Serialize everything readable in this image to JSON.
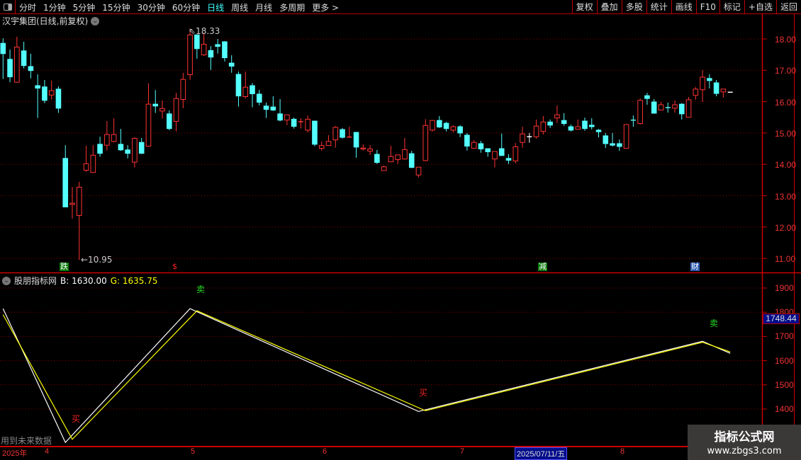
{
  "toolbar": {
    "periods": [
      "分时",
      "1分钟",
      "5分钟",
      "15分钟",
      "30分钟",
      "60分钟",
      "日线",
      "周线",
      "月线",
      "多周期",
      "更多 >"
    ],
    "active_period": "日线",
    "buttons": [
      "复权",
      "叠加",
      "多股",
      "统计",
      "画线",
      "F10",
      "标记",
      "+自选",
      "返回"
    ]
  },
  "stock": {
    "title": "汉宇集团(日线,前复权)"
  },
  "price_axis": {
    "labels": [
      "18.00",
      "17.00",
      "16.00",
      "15.00",
      "14.00",
      "13.00",
      "12.00",
      "11.00"
    ]
  },
  "annotations": {
    "high": "18.33",
    "low": "10.95",
    "markers": [
      {
        "text": "跌",
        "type": "green"
      },
      {
        "text": "$",
        "type": "red"
      },
      {
        "text": "减",
        "type": "green"
      },
      {
        "text": "财",
        "type": "blue"
      }
    ]
  },
  "indicator": {
    "name": "股朋指标网",
    "b_label": "B: 1630.00",
    "g_label": "G: 1635.75",
    "current_value": "1748.44",
    "axis_labels": [
      "1900",
      "1800",
      "1700",
      "1600",
      "1500",
      "1400"
    ],
    "signals": [
      {
        "text": "卖",
        "color": "#22dd22"
      },
      {
        "text": "买",
        "color": "#ee2222"
      },
      {
        "text": "买",
        "color": "#ee2222"
      },
      {
        "text": "卖",
        "color": "#22dd22"
      }
    ],
    "warning": "用到未来数据"
  },
  "date_axis": {
    "year": "2025年",
    "months": [
      "4",
      "5",
      "6",
      "7",
      "8"
    ],
    "cursor_date": "2025/07/11/五"
  },
  "watermark": {
    "line1": "指标公式网",
    "line2": "www.zbgs3.com"
  },
  "colors": {
    "up": "#ff3333",
    "down": "#54ffff",
    "grid": "#8b0000",
    "b_line": "#ffffff",
    "g_line": "#ffff00"
  },
  "chart_data": {
    "type": "candlestick",
    "ohlc_fields": [
      "open",
      "high",
      "low",
      "close"
    ],
    "ylim": [
      10.8,
      18.5
    ],
    "candles": [
      [
        17.86,
        18.02,
        16.72,
        17.53
      ],
      [
        17.35,
        17.66,
        16.62,
        16.79
      ],
      [
        16.62,
        18.07,
        16.62,
        17.74
      ],
      [
        17.62,
        17.91,
        17.06,
        17.15
      ],
      [
        17.12,
        17.53,
        16.74,
        16.99
      ],
      [
        16.51,
        16.87,
        15.48,
        16.43
      ],
      [
        16.47,
        16.69,
        15.95,
        16.04
      ],
      [
        16.21,
        16.67,
        16.07,
        16.35
      ],
      [
        16.4,
        16.49,
        15.64,
        15.79
      ],
      [
        14.19,
        14.61,
        12.64,
        12.64
      ],
      [
        12.72,
        13.28,
        12.27,
        12.76
      ],
      [
        12.37,
        13.44,
        10.95,
        13.27
      ],
      [
        13.81,
        14.59,
        13.76,
        14.02
      ],
      [
        13.74,
        14.61,
        13.74,
        14.29
      ],
      [
        14.64,
        14.88,
        14.24,
        14.35
      ],
      [
        14.61,
        15.38,
        14.44,
        14.95
      ],
      [
        14.73,
        15.47,
        14.7,
        14.95
      ],
      [
        14.64,
        15.13,
        14.43,
        14.46
      ],
      [
        14.46,
        14.61,
        14.19,
        14.35
      ],
      [
        14.07,
        14.86,
        13.9,
        14.83
      ],
      [
        14.7,
        14.84,
        14.33,
        14.35
      ],
      [
        14.58,
        16.58,
        14.56,
        15.92
      ],
      [
        15.92,
        16.37,
        15.64,
        15.86
      ],
      [
        15.7,
        16.04,
        15.46,
        15.78
      ],
      [
        15.61,
        15.72,
        15.09,
        15.14
      ],
      [
        15.37,
        16.28,
        15.05,
        16.1
      ],
      [
        16.07,
        16.92,
        15.79,
        16.71
      ],
      [
        16.86,
        18.33,
        16.7,
        18.13
      ],
      [
        18.13,
        18.13,
        17.37,
        17.69
      ],
      [
        17.49,
        18.2,
        17.46,
        17.83
      ],
      [
        17.63,
        17.77,
        17.01,
        17.42
      ],
      [
        17.82,
        18.0,
        17.53,
        17.76
      ],
      [
        17.91,
        17.93,
        17.28,
        17.4
      ],
      [
        17.23,
        17.48,
        16.92,
        17.13
      ],
      [
        16.87,
        16.96,
        15.84,
        16.18
      ],
      [
        16.16,
        16.96,
        16.1,
        16.46
      ],
      [
        16.51,
        16.59,
        15.82,
        16.25
      ],
      [
        16.24,
        16.37,
        15.88,
        15.98
      ],
      [
        15.86,
        15.97,
        15.48,
        15.75
      ],
      [
        15.83,
        16.17,
        15.7,
        15.73
      ],
      [
        15.61,
        16.08,
        15.37,
        15.41
      ],
      [
        15.41,
        15.58,
        15.25,
        15.58
      ],
      [
        15.44,
        15.49,
        15.14,
        15.21
      ],
      [
        15.35,
        15.47,
        15.14,
        15.36
      ],
      [
        15.09,
        15.56,
        15.02,
        15.44
      ],
      [
        15.38,
        15.38,
        14.58,
        14.64
      ],
      [
        14.51,
        14.73,
        14.43,
        14.6
      ],
      [
        14.6,
        14.93,
        14.6,
        14.73
      ],
      [
        14.78,
        15.22,
        14.53,
        15.18
      ],
      [
        15.11,
        15.16,
        14.82,
        14.86
      ],
      [
        14.85,
        15.2,
        14.85,
        14.87
      ],
      [
        15.02,
        15.02,
        14.21,
        14.55
      ],
      [
        14.49,
        14.64,
        14.44,
        14.52
      ],
      [
        14.42,
        14.61,
        14.3,
        14.49
      ],
      [
        14.32,
        14.46,
        14.01,
        14.06
      ],
      [
        13.8,
        13.96,
        13.8,
        13.92
      ],
      [
        14.08,
        14.59,
        14.08,
        14.25
      ],
      [
        14.15,
        14.3,
        14.01,
        14.3
      ],
      [
        14.17,
        14.84,
        14.15,
        14.47
      ],
      [
        14.34,
        14.43,
        13.88,
        13.9
      ],
      [
        13.66,
        13.91,
        13.58,
        13.91
      ],
      [
        14.12,
        15.44,
        14.1,
        15.24
      ],
      [
        15.09,
        15.4,
        15.05,
        15.4
      ],
      [
        15.4,
        15.54,
        15.16,
        15.19
      ],
      [
        15.31,
        15.36,
        15.05,
        15.14
      ],
      [
        15.09,
        15.25,
        15.02,
        15.2
      ],
      [
        15.2,
        15.25,
        14.87,
        15.0
      ],
      [
        14.93,
        15.0,
        14.44,
        14.58
      ],
      [
        14.51,
        14.77,
        14.51,
        14.7
      ],
      [
        14.66,
        14.75,
        14.37,
        14.49
      ],
      [
        14.5,
        14.5,
        14.24,
        14.4
      ],
      [
        14.17,
        14.41,
        13.9,
        14.41
      ],
      [
        14.5,
        14.98,
        14.28,
        14.28
      ],
      [
        14.19,
        14.32,
        14.01,
        14.13
      ],
      [
        14.11,
        14.68,
        14.03,
        14.56
      ],
      [
        14.7,
        15.2,
        14.53,
        14.97
      ],
      [
        14.88,
        15.0,
        14.69,
        14.88
      ],
      [
        14.88,
        15.43,
        14.82,
        15.22
      ],
      [
        15.05,
        15.54,
        14.95,
        15.35
      ],
      [
        15.35,
        15.43,
        15.16,
        15.25
      ],
      [
        15.48,
        15.88,
        15.32,
        15.58
      ],
      [
        15.4,
        15.63,
        15.23,
        15.3
      ],
      [
        15.2,
        15.27,
        15.05,
        15.09
      ],
      [
        15.12,
        15.43,
        15.12,
        15.2
      ],
      [
        15.38,
        15.49,
        15.07,
        15.14
      ],
      [
        15.25,
        15.47,
        15.11,
        15.2
      ],
      [
        15.09,
        15.13,
        14.86,
        15.04
      ],
      [
        14.91,
        15.0,
        14.52,
        14.66
      ],
      [
        14.66,
        15.0,
        14.57,
        14.61
      ],
      [
        14.66,
        14.79,
        14.43,
        14.57
      ],
      [
        14.51,
        15.27,
        14.51,
        15.27
      ],
      [
        15.41,
        15.56,
        15.2,
        15.39
      ],
      [
        15.3,
        16.1,
        15.27,
        16.04
      ],
      [
        16.19,
        16.28,
        15.9,
        16.1
      ],
      [
        15.99,
        16.08,
        15.63,
        15.63
      ],
      [
        15.73,
        15.99,
        15.73,
        15.9
      ],
      [
        15.81,
        15.97,
        15.65,
        15.79
      ],
      [
        15.79,
        16.04,
        15.65,
        15.9
      ],
      [
        15.92,
        15.95,
        15.43,
        15.61
      ],
      [
        15.5,
        16.15,
        15.5,
        16.06
      ],
      [
        16.2,
        16.47,
        16.06,
        16.4
      ],
      [
        16.38,
        17.0,
        15.99,
        16.78
      ],
      [
        16.74,
        16.87,
        16.42,
        16.67
      ],
      [
        16.6,
        16.69,
        16.17,
        16.26
      ],
      [
        16.31,
        16.4,
        16.13,
        16.4
      ],
      [
        16.3,
        16.3,
        16.3,
        16.3
      ]
    ],
    "indicator_ylim": [
      1250,
      1950
    ],
    "indicator_series": [
      {
        "name": "B",
        "points": [
          [
            1,
            1815
          ],
          [
            10,
            1262
          ],
          [
            28,
            1815
          ],
          [
            61,
            1390
          ],
          [
            102,
            1680
          ],
          [
            106,
            1630
          ]
        ]
      },
      {
        "name": "G",
        "points": [
          [
            1,
            1790
          ],
          [
            11,
            1275
          ],
          [
            29,
            1806
          ],
          [
            62,
            1393
          ],
          [
            102,
            1676
          ],
          [
            106,
            1636
          ]
        ]
      }
    ]
  }
}
